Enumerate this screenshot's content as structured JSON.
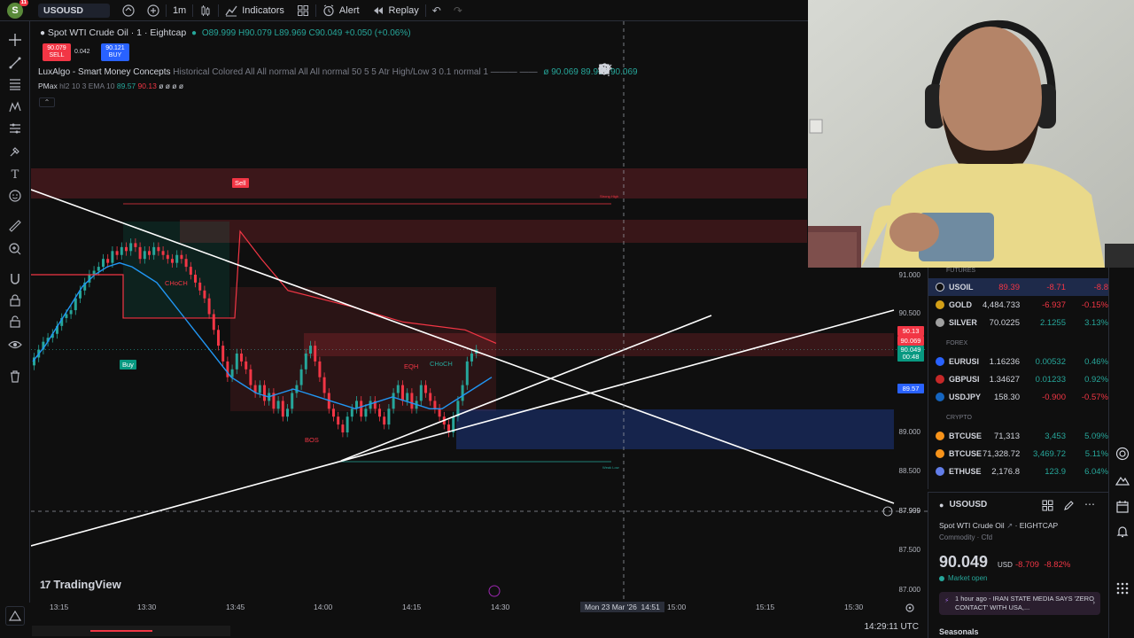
{
  "topbar": {
    "avatar_letter": "S",
    "avatar_badge": "11",
    "symbol": "USOUSD",
    "interval": "1m",
    "indicators_label": "Indicators",
    "alert_label": "Alert",
    "replay_label": "Replay"
  },
  "legend": {
    "title": "Spot WTI Crude Oil · 1 · Eightcap",
    "ohlc": "O89.999 H90.079 L89.969 C90.049 +0.050 (+0.06%)",
    "sell_price": "90.079",
    "sell_label": "SELL",
    "spread": "0.042",
    "buy_price": "90.121",
    "buy_label": "BUY",
    "ind1_name": "LuxAlgo - Smart Money Concepts",
    "ind1_params": "Historical Colored All All normal All All normal 50 5 5 Atr High/Low 3 0.1 normal 1 ——— ——",
    "ind1_values": "ø 90.069 89.969 90.069",
    "ind2_name": "PMax",
    "ind2_params": "hl2 10 3 EMA 10",
    "ind2_v1": "89.57",
    "ind2_v2": "90.13",
    "ind2_rest": "ø ø ø ø"
  },
  "chart": {
    "price_axis": [
      "91.000",
      "90.500",
      "89.000",
      "88.500",
      "87.999",
      "87.500",
      "87.000"
    ],
    "time_axis": [
      "13:15",
      "13:30",
      "13:45",
      "14:00",
      "14:15",
      "14:30",
      "15:00",
      "15:15",
      "15:30"
    ],
    "crosshair_date": "Mon 23 Mar '26",
    "crosshair_time": "14:51",
    "tags": {
      "sell": "Sell",
      "buy": "Buy",
      "choch1": "CHoCH",
      "choch2": "CHoCH",
      "eqh": "EQH",
      "bos": "BOS",
      "strong_high": "Strong High",
      "weak_low": "Weak Low"
    },
    "price_tags": {
      "p1": "90.13",
      "p2": "90.069",
      "p3": "90.049",
      "p3_time": "00:48",
      "p4": "89.57"
    },
    "logo": "TradingView"
  },
  "bottombar": {
    "utc_time": "14:29:11 UTC"
  },
  "watchlist": {
    "sections": [
      "FUTURES",
      "FOREX",
      "CRYPTO"
    ],
    "rows": [
      {
        "sym": "USOIL",
        "last": "89.39",
        "chg": "-8.71",
        "pct": "-8.8",
        "color": "#0f0f0f",
        "chg_color": "#f23645"
      },
      {
        "sym": "GOLD",
        "last": "4,484.733",
        "chg": "-6.937",
        "pct": "-0.15%",
        "color": "#d4a017",
        "chg_color": "#f23645"
      },
      {
        "sym": "SILVER",
        "last": "70.0225",
        "chg": "2.1255",
        "pct": "3.13%",
        "color": "#a0a0a0",
        "chg_color": "#26a69a"
      },
      {
        "sym": "EURUSI",
        "last": "1.16236",
        "chg": "0.00532",
        "pct": "0.46%",
        "color": "#2962ff",
        "chg_color": "#26a69a"
      },
      {
        "sym": "GBPUSI",
        "last": "1.34627",
        "chg": "0.01233",
        "pct": "0.92%",
        "color": "#c62828",
        "chg_color": "#26a69a"
      },
      {
        "sym": "USDJPY",
        "last": "158.30",
        "chg": "-0.900",
        "pct": "-0.57%",
        "color": "#1565c0",
        "chg_color": "#f23645"
      },
      {
        "sym": "BTCUSE",
        "last": "71,313",
        "chg": "3,453",
        "pct": "5.09%",
        "color": "#f7931a",
        "chg_color": "#26a69a"
      },
      {
        "sym": "BTCUSE",
        "last": "71,328.72",
        "chg": "3,469.72",
        "pct": "5.11%",
        "color": "#f7931a",
        "chg_color": "#26a69a"
      },
      {
        "sym": "ETHUSE",
        "last": "2,176.8",
        "chg": "123.9",
        "pct": "6.04%",
        "color": "#627eea",
        "chg_color": "#26a69a"
      }
    ]
  },
  "details": {
    "symbol": "USOUSD",
    "name": "Spot WTI Crude Oil",
    "exchange": "EIGHTCAP",
    "category": "Commodity · Cfd",
    "price": "90.049",
    "currency": "USD",
    "change": "-8.709",
    "change_pct": "-8.82%",
    "status": "Market open",
    "news_time": "1 hour ago",
    "news_text": "IRAN STATE MEDIA SAYS 'ZERO CONTACT' WITH USA,...",
    "seasonals": "Seasonals"
  }
}
